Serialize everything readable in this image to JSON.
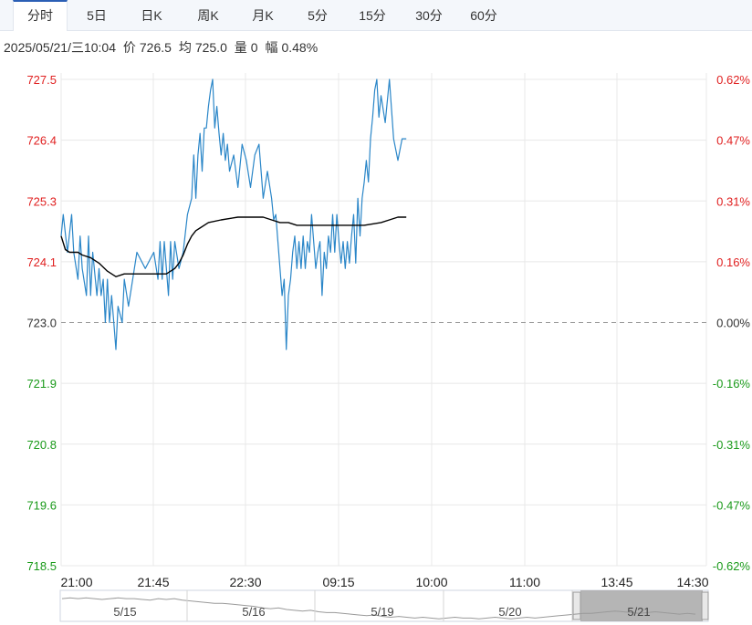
{
  "tabs": [
    {
      "label": "分时",
      "active": true
    },
    {
      "label": "5日",
      "active": false
    },
    {
      "label": "日K",
      "active": false
    },
    {
      "label": "周K",
      "active": false
    },
    {
      "label": "月K",
      "active": false
    },
    {
      "label": "5分",
      "active": false
    },
    {
      "label": "15分",
      "active": false
    },
    {
      "label": "30分",
      "active": false
    },
    {
      "label": "60分",
      "active": false
    }
  ],
  "info": {
    "datetime": "2025/05/21/三10:04",
    "price_label": "价",
    "price": "726.5",
    "avg_label": "均",
    "avg": "725.0",
    "volume_label": "量",
    "volume": "0",
    "range_label": "幅",
    "range": "0.48%"
  },
  "colors": {
    "up": "#e02020",
    "down": "#1a9a1a",
    "neutral": "#333333",
    "price_line": "#2a86c8",
    "avg_line": "#000000",
    "baseline": "#999999",
    "grid": "#e8e8e8"
  },
  "chart_data": {
    "type": "line",
    "title": "",
    "xlabel": "",
    "ylabel": "",
    "ylim": [
      718.5,
      727.5
    ],
    "y_ticks_left": [
      "727.5",
      "726.4",
      "725.3",
      "724.1",
      "723.0",
      "721.9",
      "720.8",
      "719.6",
      "718.5"
    ],
    "y_ticks_right": [
      "0.62%",
      "0.47%",
      "0.31%",
      "0.16%",
      "0.00%",
      "-0.16%",
      "-0.31%",
      "-0.47%",
      "-0.62%"
    ],
    "x_ticks": [
      "21:00",
      "21:45",
      "22:30",
      "09:15",
      "10:00",
      "11:00",
      "13:45",
      "14:30"
    ],
    "baseline": 723.0,
    "series": [
      {
        "role": "price",
        "x": [
          0,
          1,
          3,
          5,
          6,
          8,
          9,
          10,
          12,
          13,
          14,
          15,
          17,
          18,
          19,
          20,
          21,
          22,
          23,
          24,
          25,
          26,
          27,
          29,
          30,
          32,
          34,
          36,
          40,
          44,
          46,
          47,
          48,
          49,
          50,
          51,
          52,
          53,
          54,
          56,
          58,
          60,
          62,
          63,
          64,
          65,
          66,
          67,
          68,
          69,
          70,
          71,
          72,
          73,
          74,
          75,
          76,
          77,
          78,
          79,
          80,
          82,
          84,
          86,
          88,
          90,
          92,
          94,
          96,
          98,
          100,
          101,
          102,
          103,
          104,
          105,
          106,
          107,
          108,
          109,
          110,
          111,
          112,
          113,
          114,
          115,
          116,
          117,
          118,
          119,
          120,
          121,
          122,
          123,
          124,
          125,
          126,
          127,
          128,
          129,
          130,
          131,
          132,
          133,
          134,
          135,
          136,
          137,
          138,
          139,
          140,
          141,
          142,
          143,
          144,
          145,
          146,
          147,
          148,
          149,
          150,
          151,
          152,
          154,
          156,
          158,
          160,
          162,
          164
        ],
        "values": [
          724.6,
          725.0,
          724.3,
          725.0,
          724.3,
          723.8,
          724.6,
          724.0,
          723.5,
          724.6,
          723.5,
          724.3,
          723.5,
          724.0,
          723.5,
          723.8,
          723.0,
          723.8,
          723.0,
          723.5,
          723.0,
          722.5,
          723.3,
          723.0,
          723.8,
          723.3,
          723.8,
          724.3,
          724.0,
          724.3,
          723.8,
          724.5,
          723.8,
          724.5,
          724.0,
          723.5,
          724.5,
          723.8,
          724.5,
          724.0,
          724.3,
          725.0,
          725.3,
          726.1,
          725.3,
          726.1,
          726.5,
          725.8,
          726.6,
          726.6,
          727.0,
          727.3,
          727.5,
          726.6,
          727.0,
          726.5,
          726.1,
          726.5,
          726.0,
          726.3,
          725.8,
          726.1,
          725.5,
          726.3,
          726.0,
          725.5,
          726.1,
          726.3,
          725.3,
          725.8,
          725.3,
          724.9,
          725.0,
          724.5,
          724.0,
          723.5,
          723.8,
          722.5,
          723.5,
          723.8,
          724.3,
          724.6,
          724.0,
          724.5,
          724.0,
          724.6,
          724.0,
          724.5,
          724.3,
          725.0,
          724.5,
          724.0,
          724.3,
          724.5,
          723.5,
          724.3,
          724.0,
          724.6,
          724.3,
          725.0,
          724.3,
          725.0,
          724.5,
          724.1,
          724.5,
          724.0,
          724.5,
          724.1,
          724.6,
          725.0,
          724.1,
          725.3,
          724.6,
          725.3,
          725.6,
          726.0,
          725.6,
          726.4,
          726.8,
          727.3,
          727.5,
          726.8,
          727.2,
          726.7,
          727.5,
          726.4,
          726.0,
          726.4,
          726.4
        ]
      },
      {
        "role": "average",
        "x": [
          0,
          2,
          4,
          6,
          8,
          10,
          14,
          18,
          22,
          26,
          30,
          34,
          38,
          42,
          46,
          50,
          52,
          54,
          56,
          58,
          60,
          62,
          64,
          66,
          70,
          76,
          84,
          90,
          96,
          100,
          104,
          108,
          112,
          116,
          120,
          128,
          136,
          144,
          152,
          156,
          160,
          164
        ],
        "values": [
          724.6,
          724.35,
          724.3,
          724.3,
          724.3,
          724.25,
          724.2,
          724.1,
          723.95,
          723.85,
          723.9,
          723.9,
          723.9,
          723.9,
          723.9,
          723.9,
          723.95,
          724.0,
          724.1,
          724.25,
          724.45,
          724.6,
          724.7,
          724.75,
          724.85,
          724.9,
          724.95,
          724.95,
          724.95,
          724.9,
          724.85,
          724.85,
          724.8,
          724.8,
          724.8,
          724.8,
          724.8,
          724.8,
          724.85,
          724.9,
          724.95,
          724.95
        ]
      }
    ],
    "navigator_labels": [
      "5/15",
      "5/16",
      "5/19",
      "5/20",
      "5/21"
    ]
  }
}
